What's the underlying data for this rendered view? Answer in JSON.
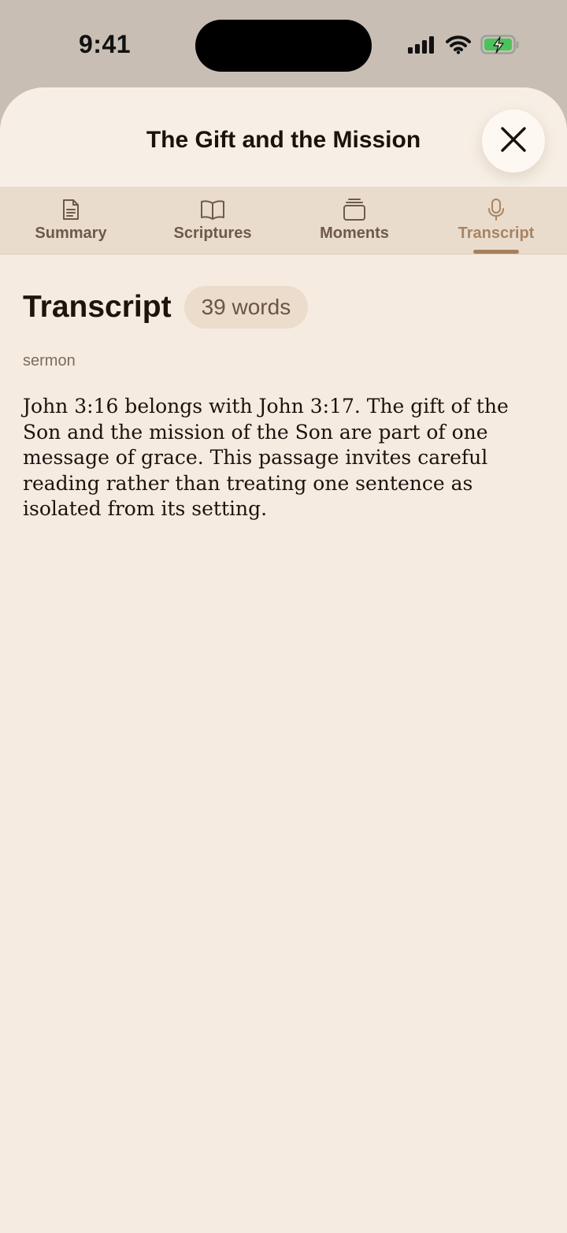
{
  "status_bar": {
    "time": "9:41",
    "icons": [
      "cellular-signal-icon",
      "wifi-icon",
      "battery-charging-icon"
    ],
    "battery_color": "#4cc35a"
  },
  "sheet": {
    "title": "The Gift and the Mission",
    "close_icon": "close-icon"
  },
  "tabs": [
    {
      "label": "Summary",
      "icon": "document-icon",
      "active": false
    },
    {
      "label": "Scriptures",
      "icon": "open-book-icon",
      "active": false
    },
    {
      "label": "Moments",
      "icon": "stack-icon",
      "active": false
    },
    {
      "label": "Transcript",
      "icon": "microphone-icon",
      "active": true
    }
  ],
  "content": {
    "title": "Transcript",
    "word_count": "39 words",
    "subtitle": "sermon",
    "body": "John 3:16 belongs with John 3:17. The gift of the Son and the mission of the Son are part of one message of grace. This passage invites careful reading rather than treating one sentence as isolated from its setting."
  },
  "colors": {
    "sheet_background": "#f5ebe1",
    "tab_bar_background": "#eadccd",
    "active_tab": "#a88462",
    "text_primary": "#1e140d"
  }
}
